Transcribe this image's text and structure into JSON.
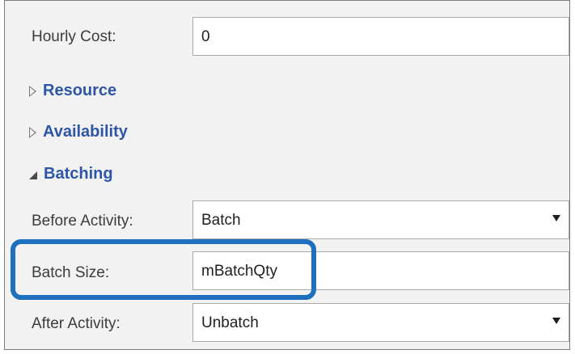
{
  "properties": {
    "hourly_cost": {
      "label": "Hourly Cost:",
      "value": "0"
    },
    "sections": {
      "resource": "Resource",
      "availability": "Availability",
      "batching": "Batching"
    },
    "before_activity": {
      "label": "Before Activity:",
      "value": "Batch"
    },
    "batch_size": {
      "label": "Batch Size:",
      "value": "mBatchQty"
    },
    "after_activity": {
      "label": "After Activity:",
      "value": "Unbatch"
    }
  },
  "colors": {
    "section_title": "#2e56a6",
    "highlight_border": "#1f6fbf",
    "panel_background": "#f2f2f2"
  },
  "icons": {
    "collapsed": "triangle-right-outline",
    "expanded": "triangle-down-filled",
    "dropdown": "chevron-down"
  }
}
